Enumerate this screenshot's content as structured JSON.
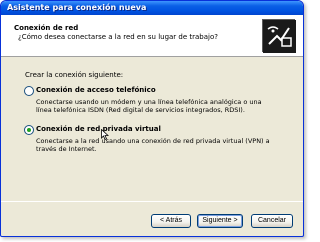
{
  "window": {
    "title": "Asistente para conexión nueva"
  },
  "header": {
    "title": "Conexión de red",
    "subtitle": "¿Cómo desea conectarse a la red en su lugar de trabajo?",
    "icon": "network-wizard-icon"
  },
  "prompt": "Crear la conexión siguiente:",
  "options": [
    {
      "title": "Conexión de acceso telefónico",
      "description": "Conectarse usando un módem y una línea telefónica analógica o una línea telefónica ISDN (Red digital de servicios integrados, RDSI).",
      "selected": false
    },
    {
      "title": "Conexión de red privada virtual",
      "description": "Conectarse a la red usando una conexión de red privada virtual (VPN) a través de Internet.",
      "selected": true
    }
  ],
  "buttons": {
    "back": "< Atrás",
    "next": "Siguiente >",
    "cancel": "Cancelar"
  },
  "colors": {
    "titlebar": "#0053e1",
    "window_bg": "#ece9d8",
    "radio_dot": "#21a121"
  }
}
